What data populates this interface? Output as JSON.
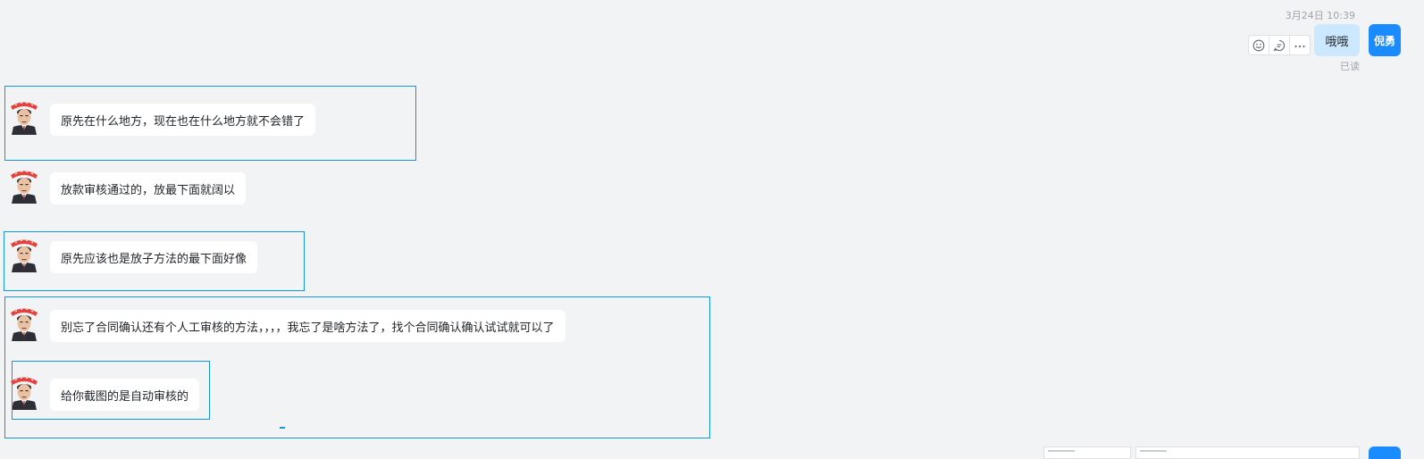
{
  "outgoing": {
    "timestamp": "3月24日 10:39",
    "text": "哦哦",
    "read_status": "已读",
    "avatar_name": "倪勇",
    "toolbar_icons": [
      "emoji-reaction-icon",
      "reply-icon",
      "more-icon"
    ]
  },
  "incoming": [
    {
      "text": "原先在什么地方，现在也在什么地方就不会错了"
    },
    {
      "text": "放款审核通过的，放最下面就阔以"
    },
    {
      "text": "原先应该也是放子方法的最下面好像"
    },
    {
      "text": "别忘了合同确认还有个人工审核的方法，，，，我忘了是啥方法了，找个合同确认确认试试就可以了"
    },
    {
      "text": "给你截图的是自动审核的"
    }
  ],
  "colors": {
    "background": "#f2f3f5",
    "selection_outline": "#1296db",
    "outgoing_bubble": "#cce8ff",
    "my_avatar": "#1a8cff",
    "sticker_red": "#e8413c"
  }
}
